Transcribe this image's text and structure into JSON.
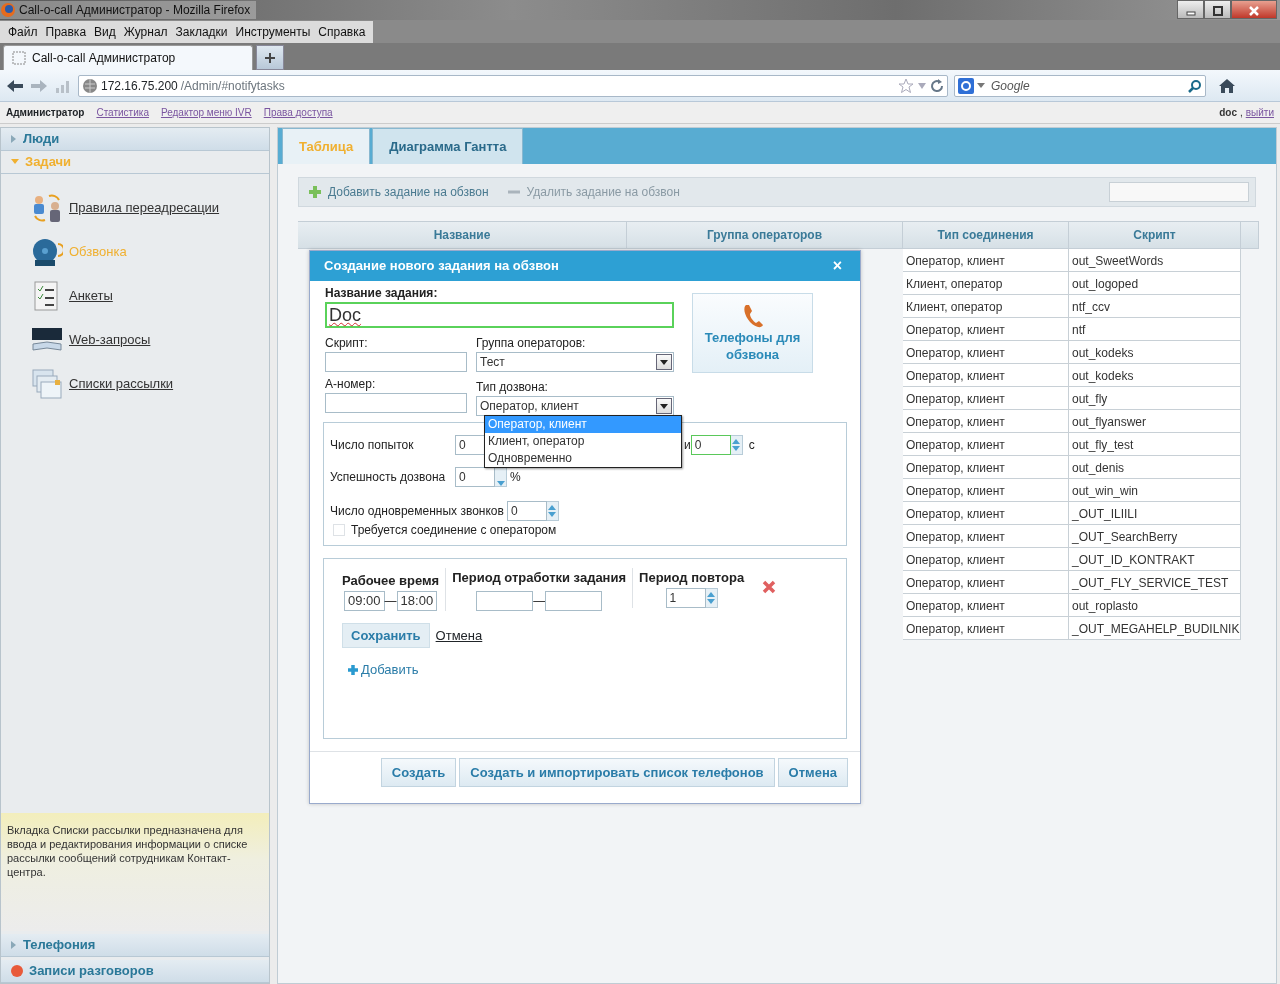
{
  "window": {
    "title": "Call-o-call Администратор - Mozilla Firefox"
  },
  "menu": [
    "Файл",
    "Правка",
    "Вид",
    "Журнал",
    "Закладки",
    "Инструменты",
    "Справка"
  ],
  "browser_tab": {
    "title": "Call-o-call Администратор"
  },
  "address": {
    "host": "172.16.75.200",
    "path": "/Admin/#notifytasks"
  },
  "search": {
    "placeholder": "Google"
  },
  "app_nav": {
    "items": [
      {
        "label": "Администратор",
        "selected": true
      },
      {
        "label": "Статистика",
        "selected": false
      },
      {
        "label": "Редактор меню IVR",
        "selected": false
      },
      {
        "label": "Права доступа",
        "selected": false
      }
    ],
    "user": "doc",
    "separator": ",",
    "logout": "выйти"
  },
  "sidebar": {
    "sections": [
      {
        "label": "Люди",
        "expanded": false
      },
      {
        "label": "Задачи",
        "expanded": true,
        "items": [
          {
            "label": "Правила переадресации",
            "kind": "forward",
            "selected": false
          },
          {
            "label": "Обзвонка",
            "kind": "ring",
            "selected": true
          },
          {
            "label": "Анкеты",
            "kind": "survey",
            "selected": false
          },
          {
            "label": "Web-запросы",
            "kind": "web",
            "selected": false
          },
          {
            "label": "Списки рассылки",
            "kind": "mailing",
            "selected": false
          }
        ]
      }
    ],
    "info": "Вкладка Списки рассылки предназначена для ввода и редактирования информации о списке рассылки сообщений сотрудникам Контакт-центра.",
    "bottom_sections": [
      {
        "label": "Телефония",
        "kind": "arrow"
      },
      {
        "label": "Записи разговоров",
        "kind": "dot"
      }
    ]
  },
  "tabs": [
    {
      "label": "Таблица",
      "selected": true
    },
    {
      "label": "Диаграмма Гантта",
      "selected": false
    }
  ],
  "toolbar": [
    {
      "label": "Добавить задание на обзвон",
      "kind": "add",
      "disabled": false
    },
    {
      "label": "Удалить задание на обзвон",
      "kind": "remove",
      "disabled": true
    }
  ],
  "table": {
    "columns": [
      "Название",
      "Группа операторов",
      "Тип соединения",
      "Скрипт"
    ],
    "rows": [
      {
        "connection_type": "Оператор, клиент",
        "script": "out_SweetWords"
      },
      {
        "connection_type": "Клиент, оператор",
        "script": "out_logoped"
      },
      {
        "connection_type": "Клиент, оператор",
        "script": "ntf_ccv"
      },
      {
        "connection_type": "Оператор, клиент",
        "script": "ntf"
      },
      {
        "connection_type": "Оператор, клиент",
        "script": "out_kodeks"
      },
      {
        "connection_type": "Оператор, клиент",
        "script": "out_kodeks"
      },
      {
        "connection_type": "Оператор, клиент",
        "script": "out_fly"
      },
      {
        "connection_type": "Оператор, клиент",
        "script": "out_flyanswer"
      },
      {
        "connection_type": "Оператор, клиент",
        "script": "out_fly_test"
      },
      {
        "connection_type": "Оператор, клиент",
        "script": "out_denis"
      },
      {
        "connection_type": "Оператор, клиент",
        "script": "out_win_win"
      },
      {
        "connection_type": "Оператор, клиент",
        "script": "_OUT_ILIILI"
      },
      {
        "connection_type": "Оператор, клиент",
        "script": "_OUT_SearchBerry"
      },
      {
        "connection_type": "Оператор, клиент",
        "script": "_OUT_ID_KONTRAKT"
      },
      {
        "connection_type": "Оператор, клиент",
        "script": "_OUT_FLY_SERVICE_TEST"
      },
      {
        "connection_type": "Оператор, клиент",
        "script": "out_roplasto"
      },
      {
        "connection_type": "Оператор, клиент",
        "script": "_OUT_MEGAHELP_BUDILNIK"
      }
    ]
  },
  "dialog": {
    "title": "Создание нового задания на обзвон",
    "close": "×",
    "name_label": "Название задания:",
    "name_value": "Doc",
    "script_label": "Скрипт:",
    "group_label": "Группа операторов:",
    "group_value": "Тест",
    "anumber_label": "А-номер:",
    "dial_type_label": "Тип дозвона:",
    "dial_type_value": "Оператор, клиент",
    "dial_type_options": [
      {
        "label": "Оператор, клиент",
        "selected": true
      },
      {
        "label": "Клиент, оператор",
        "selected": false
      },
      {
        "label": "Одновременно",
        "selected": false
      }
    ],
    "phones_button": "Телефоны для обзвона",
    "attempts_label": "Число попыток",
    "attempts_value": "0",
    "interval_label": "и",
    "interval_value": "0",
    "interval_unit": "с",
    "success_label": "Успешность дозвона",
    "success_value": "0",
    "success_unit": "%",
    "concurrent_label": "Число одновременных звонков",
    "concurrent_value": "0",
    "require_operator": {
      "label": "Требуется соединение с оператором",
      "checked": false
    },
    "schedule": {
      "headers": [
        "Рабочее время",
        "Период отработки задания",
        "Период повтора"
      ],
      "work_from": "09:00",
      "work_to": "18:00",
      "dash": "—",
      "repeat_value": "1",
      "save": "Сохранить",
      "cancel": "Отмена",
      "add": "Добавить"
    },
    "buttons": [
      "Создать",
      "Создать и импортировать список телефонов",
      "Отмена"
    ]
  }
}
